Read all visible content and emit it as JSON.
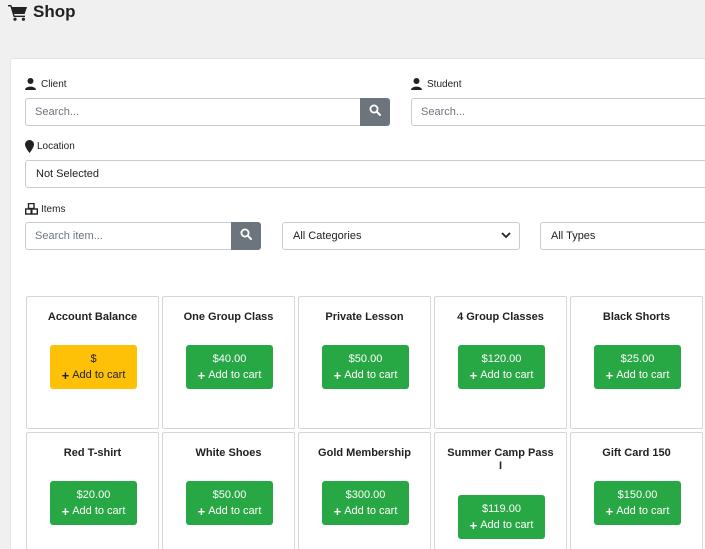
{
  "page": {
    "title": "Shop"
  },
  "filters": {
    "client_label": "Client",
    "client_placeholder": "Search...",
    "student_label": "Student",
    "student_placeholder": "Search...",
    "location_label": "Location",
    "location_value": "Not Selected",
    "items_label": "Items",
    "item_search_placeholder": "Search item...",
    "category_value": "All Categories",
    "type_value": "All Types"
  },
  "products": [
    {
      "name": "Account Balance",
      "price": "$",
      "action": "Add to cart",
      "style": "yellow"
    },
    {
      "name": "One Group Class",
      "price": "$40.00",
      "action": "Add to cart",
      "style": "green"
    },
    {
      "name": "Private Lesson",
      "price": "$50.00",
      "action": "Add to cart",
      "style": "green"
    },
    {
      "name": "4 Group Classes",
      "price": "$120.00",
      "action": "Add to cart",
      "style": "green"
    },
    {
      "name": "Black Shorts",
      "price": "$25.00",
      "action": "Add to cart",
      "style": "green"
    },
    {
      "name": "Red T-shirt",
      "price": "$20.00",
      "action": "Add to cart",
      "style": "green"
    },
    {
      "name": "White Shoes",
      "price": "$50.00",
      "action": "Add to cart",
      "style": "green"
    },
    {
      "name": "Gold Membership",
      "price": "$300.00",
      "action": "Add to cart",
      "style": "green"
    },
    {
      "name": "Summer Camp Pass I",
      "price": "$119.00",
      "action": "Add to cart",
      "style": "green"
    },
    {
      "name": "Gift Card 150",
      "price": "$150.00",
      "action": "Add to cart",
      "style": "green"
    }
  ],
  "colors": {
    "green": "#28a745",
    "yellow": "#ffc107",
    "search_button": "#6c757d"
  }
}
